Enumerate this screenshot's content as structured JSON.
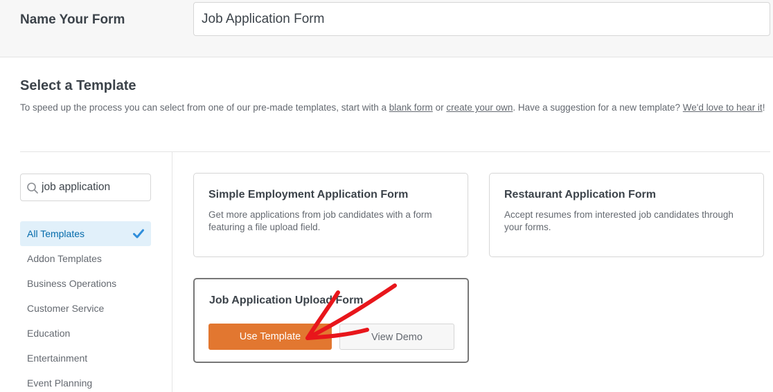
{
  "form_name": {
    "label": "Name Your Form",
    "value": "Job Application Form"
  },
  "templates_section": {
    "title": "Select a Template",
    "desc_part1": "To speed up the process you can select from one of our pre-made templates, start with a ",
    "blank_form_link": "blank form",
    "desc_part2": " or ",
    "create_own_link": "create your own",
    "desc_part3": ". Have a suggestion for a new template? ",
    "love_to_hear_link": "We'd love to hear it",
    "desc_part4": "!"
  },
  "search": {
    "value": "job application",
    "icon": "search-icon"
  },
  "categories": [
    {
      "label": "All Templates",
      "active": true
    },
    {
      "label": "Addon Templates"
    },
    {
      "label": "Business Operations"
    },
    {
      "label": "Customer Service"
    },
    {
      "label": "Education"
    },
    {
      "label": "Entertainment"
    },
    {
      "label": "Event Planning"
    }
  ],
  "cards": [
    {
      "title": "Simple Employment Application Form",
      "desc": "Get more applications from job candidates with a form featuring a file upload field."
    },
    {
      "title": "Restaurant Application Form",
      "desc": "Accept resumes from interested job candidates through your forms."
    },
    {
      "title": "Job Application Upload Form",
      "use_label": "Use Template",
      "demo_label": "View Demo"
    }
  ],
  "colors": {
    "accent_orange": "#e27730",
    "active_blue": "#036aab",
    "active_bg": "#e1f0fa",
    "annotation_red": "#e8161b"
  }
}
